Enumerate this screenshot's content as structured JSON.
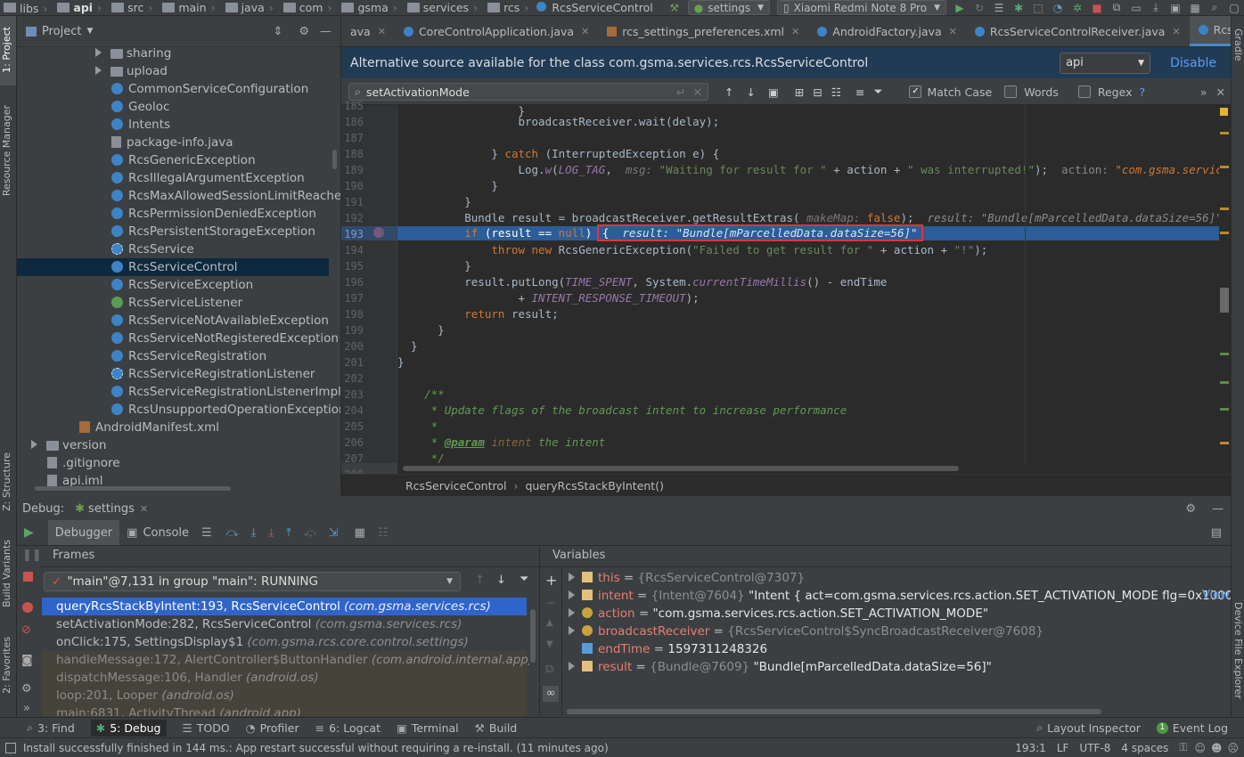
{
  "breadcrumb": [
    "libs",
    "api",
    "src",
    "main",
    "java",
    "com",
    "gsma",
    "services",
    "rcs"
  ],
  "breadcrumb_file": "RcsServiceControl",
  "run_config": "settings",
  "device": "Xiaomi Redmi Note 8 Pro",
  "project": {
    "title": "Project",
    "items": [
      {
        "label": "sharing",
        "kind": "folder",
        "indent": 88
      },
      {
        "label": "upload",
        "kind": "folder",
        "indent": 88
      },
      {
        "label": "CommonServiceConfiguration",
        "kind": "class",
        "indent": 106
      },
      {
        "label": "Geoloc",
        "kind": "class",
        "indent": 106
      },
      {
        "label": "Intents",
        "kind": "class",
        "indent": 106
      },
      {
        "label": "package-info.java",
        "kind": "file",
        "indent": 106
      },
      {
        "label": "RcsGenericException",
        "kind": "class",
        "indent": 106
      },
      {
        "label": "RcsIllegalArgumentException",
        "kind": "class",
        "indent": 106
      },
      {
        "label": "RcsMaxAllowedSessionLimitReached",
        "kind": "class",
        "indent": 106
      },
      {
        "label": "RcsPermissionDeniedException",
        "kind": "class",
        "indent": 106
      },
      {
        "label": "RcsPersistentStorageException",
        "kind": "class",
        "indent": 106
      },
      {
        "label": "RcsService",
        "kind": "abstract",
        "indent": 106
      },
      {
        "label": "RcsServiceControl",
        "kind": "class",
        "indent": 106,
        "selected": true
      },
      {
        "label": "RcsServiceException",
        "kind": "class",
        "indent": 106
      },
      {
        "label": "RcsServiceListener",
        "kind": "interface",
        "indent": 106
      },
      {
        "label": "RcsServiceNotAvailableException",
        "kind": "class",
        "indent": 106
      },
      {
        "label": "RcsServiceNotRegisteredException",
        "kind": "class",
        "indent": 106
      },
      {
        "label": "RcsServiceRegistration",
        "kind": "class",
        "indent": 106
      },
      {
        "label": "RcsServiceRegistrationListener",
        "kind": "abstract",
        "indent": 106
      },
      {
        "label": "RcsServiceRegistrationListenerImpl",
        "kind": "class",
        "indent": 106
      },
      {
        "label": "RcsUnsupportedOperationException",
        "kind": "class",
        "indent": 106
      },
      {
        "label": "AndroidManifest.xml",
        "kind": "xml",
        "indent": 70
      },
      {
        "label": "version",
        "kind": "folder",
        "indent": 16
      },
      {
        "label": ".gitignore",
        "kind": "file",
        "indent": 34
      },
      {
        "label": "api.iml",
        "kind": "file",
        "indent": 34
      }
    ]
  },
  "tabs": [
    {
      "label": "ava",
      "kind": "none"
    },
    {
      "label": "CoreControlApplication.java",
      "kind": "class"
    },
    {
      "label": "rcs_settings_preferences.xml",
      "kind": "xml"
    },
    {
      "label": "AndroidFactory.java",
      "kind": "class"
    },
    {
      "label": "RcsServiceControlReceiver.java",
      "kind": "class"
    },
    {
      "label": "RcsServiceControl.java",
      "kind": "class",
      "active": true
    }
  ],
  "tabs_more": "≡5",
  "notification": {
    "message": "Alternative source available for the class com.gsma.services.rcs.RcsServiceControl",
    "select": "api",
    "action": "Disable"
  },
  "search": {
    "query": "setActivationMode",
    "match_case": "Match Case",
    "words": "Words",
    "regex": "Regex",
    "help": "?"
  },
  "code": {
    "line_numbers": [
      "185",
      "186",
      "187",
      "188",
      "189",
      "190",
      "191",
      "192",
      "193",
      "194",
      "195",
      "196",
      "197",
      "198",
      "199",
      "200",
      "201",
      "202",
      "203",
      "204",
      "205",
      "206",
      "207",
      "208"
    ]
  },
  "editor_breadcrumb": [
    "RcsServiceControl",
    "queryRcsStackByIntent()"
  ],
  "debug": {
    "label": "Debug:",
    "session": "settings",
    "tab_debugger": "Debugger",
    "tab_console": "Console",
    "frames_title": "Frames",
    "variables_title": "Variables",
    "thread": "\"main\"@7,131 in group \"main\": RUNNING",
    "frames": [
      {
        "method": "queryRcsStackByIntent:193, RcsServiceControl",
        "pkg": "(com.gsma.services.rcs)",
        "state": "selected"
      },
      {
        "method": "setActivationMode:282, RcsServiceControl",
        "pkg": "(com.gsma.services.rcs)",
        "state": "normal"
      },
      {
        "method": "onClick:175, SettingsDisplay$1",
        "pkg": "(com.gsma.rcs.core.control.settings)",
        "state": "normal"
      },
      {
        "method": "handleMessage:172, AlertController$ButtonHandler",
        "pkg": "(com.android.internal.app)",
        "state": "lib"
      },
      {
        "method": "dispatchMessage:106, Handler",
        "pkg": "(android.os)",
        "state": "lib"
      },
      {
        "method": "loop:201, Looper",
        "pkg": "(android.os)",
        "state": "lib"
      },
      {
        "method": "main:6831, ActivityThread",
        "pkg": "(android.app)",
        "state": "lib"
      }
    ],
    "variables": [
      {
        "name": "this",
        "type": "{RcsServiceControl@7307}",
        "value": "",
        "icon": "field",
        "expandable": true
      },
      {
        "name": "intent",
        "type": "{Intent@7604}",
        "value": "\"Intent { act=com.gsma.services.rcs.action.SET_ACTIVATION_MODE flg=0x1000001(...",
        "icon": "field",
        "expandable": true,
        "link": "View"
      },
      {
        "name": "action",
        "type": "",
        "value": "\"com.gsma.services.rcs.action.SET_ACTIVATION_MODE\"",
        "icon": "param",
        "expandable": true
      },
      {
        "name": "broadcastReceiver",
        "type": "{RcsServiceControl$SyncBroadcastReceiver@7608}",
        "value": "",
        "icon": "param",
        "expandable": true
      },
      {
        "name": "endTime",
        "type": "",
        "value": "1597311248326",
        "icon": "long",
        "expandable": false
      },
      {
        "name": "result",
        "type": "{Bundle@7609}",
        "value": "\"Bundle[mParcelledData.dataSize=56]\"",
        "icon": "field",
        "expandable": true
      }
    ]
  },
  "bottom_tabs": [
    {
      "label": "3: Find"
    },
    {
      "label": "5: Debug",
      "active": true
    },
    {
      "label": "TODO"
    },
    {
      "label": "Profiler"
    },
    {
      "label": "6: Logcat"
    },
    {
      "label": "Terminal"
    },
    {
      "label": "Build"
    }
  ],
  "bottom_right": [
    "Layout Inspector",
    "Event Log"
  ],
  "event_log_count": "1",
  "status": {
    "message": "Install successfully finished in 144 ms.: App restart successful without requiring a re-install. (11 minutes ago)",
    "position": "193:1",
    "line_sep": "LF",
    "encoding": "UTF-8",
    "indent": "4 spaces"
  },
  "side_labels": {
    "project": "1: Project",
    "resource": "Resource Manager",
    "structure": "Z: Structure",
    "build_variants": "Build Variants",
    "favorites": "2: Favorites",
    "gradle": "Gradle",
    "device_file": "Device File Explorer"
  }
}
